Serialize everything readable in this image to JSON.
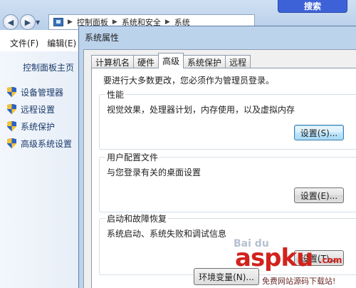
{
  "explorer": {
    "address": {
      "segments": [
        "控制面板",
        "系统和安全",
        "系统"
      ]
    },
    "search_label": "搜索",
    "menu": [
      "文件(F)",
      "编辑(E)"
    ],
    "sidebar": {
      "home": "控制面板主页",
      "items": [
        "设备管理器",
        "远程设置",
        "系统保护",
        "高级系统设置"
      ]
    }
  },
  "dialog": {
    "title": "系统属性",
    "tabs": [
      "计算机名",
      "硬件",
      "高级",
      "系统保护",
      "远程"
    ],
    "active_tab": "高级",
    "admin_note": "要进行大多数更改，您必须作为管理员登录。",
    "groups": [
      {
        "title": "性能",
        "desc": "视觉效果，处理器计划，内存使用，以及虚拟内存",
        "button": "设置(S)..."
      },
      {
        "title": "用户配置文件",
        "desc": "与您登录有关的桌面设置",
        "button": "设置(E)..."
      },
      {
        "title": "启动和故障恢复",
        "desc": "系统启动、系统失败和调试信息",
        "button": "设置(T)..."
      }
    ],
    "bottom_button": "环境变量(N)..."
  },
  "watermark": {
    "main": "aspku",
    "com": ".com",
    "sub": "免费网站源码下载站!"
  }
}
